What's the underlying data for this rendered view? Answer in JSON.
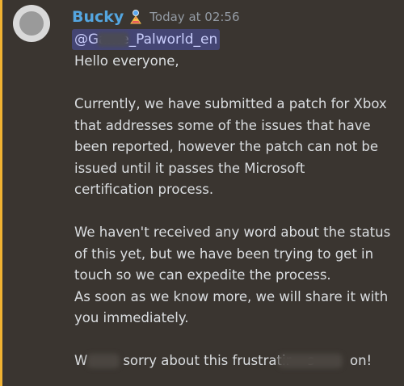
{
  "message": {
    "author": "Bucky",
    "timestamp": "Today at 02:56",
    "mention": "@Game_Palworld_en",
    "lines": [
      "Hello everyone,",
      "",
      "Currently, we have submitted a patch for Xbox",
      "that addresses some of the issues that have",
      "been reported, however the patch can not be",
      "issued until it passes the Microsoft",
      "certification process.",
      "",
      "We haven't received any word about the status",
      "of this yet, but we have been trying to get in",
      "touch so we can expedite the process.",
      "As soon as we know more, we will share it with",
      "you immediately.",
      ""
    ],
    "closing_parts": [
      "W",
      "sorry about this frustratir",
      "s",
      "on!"
    ]
  },
  "icons": {
    "avatar": "avatar-image",
    "role": "role-badge-icon"
  },
  "colors": {
    "username": "#54a6e0",
    "mention_bg": "#5865f2",
    "accent_bar": "#f0b232"
  }
}
